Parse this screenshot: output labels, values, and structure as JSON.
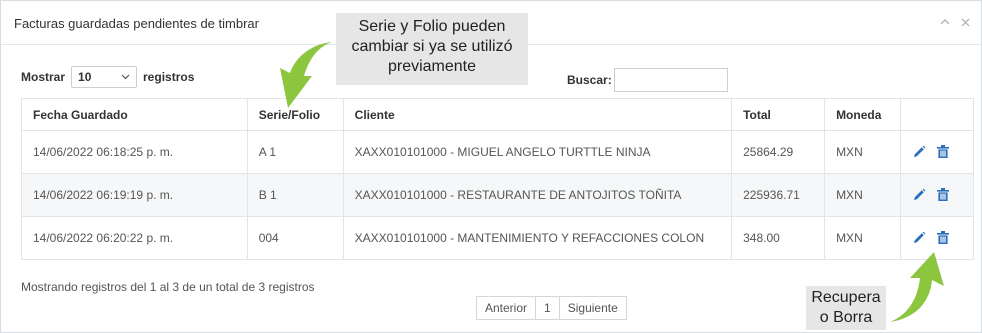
{
  "panel": {
    "title": "Facturas guardadas pendientes de timbrar",
    "collapse_icon": "chevron-up-icon",
    "close_icon": "close-icon"
  },
  "annotations": {
    "serie_note_lines": [
      "Serie y Folio pueden",
      "cambiar si ya se utilizó",
      "previamente"
    ],
    "actions_note_lines": [
      "Recupera",
      "o Borra"
    ],
    "arrow_color": "#8cc63f"
  },
  "controls": {
    "show_label": "Mostrar",
    "page_length": "10",
    "records_label": "registros",
    "search_label": "Buscar:",
    "search_value": ""
  },
  "table": {
    "columns": [
      "Fecha Guardado",
      "Serie/Folio",
      "Cliente",
      "Total",
      "Moneda",
      ""
    ],
    "rows": [
      {
        "fecha": "14/06/2022 06:18:25 p. m.",
        "serie": "A 1",
        "cliente": "XAXX010101000 - MIGUEL ANGELO TURTTLE NINJA",
        "total": "25864.29",
        "moneda": "MXN"
      },
      {
        "fecha": "14/06/2022 06:19:19 p. m.",
        "serie": "B 1",
        "cliente": "XAXX010101000 - RESTAURANTE DE ANTOJITOS TOÑITA",
        "total": "225936.71",
        "moneda": "MXN"
      },
      {
        "fecha": "14/06/2022 06:20:22 p. m.",
        "serie": "004",
        "cliente": "XAXX010101000 - MANTENIMIENTO Y REFACCIONES COLON",
        "total": "348.00",
        "moneda": "MXN"
      }
    ],
    "edit_icon": "pencil-icon",
    "delete_icon": "trash-icon",
    "icon_color": "#2a6ebb"
  },
  "footer": {
    "info": "Mostrando registros del 1 al 3 de un total de 3 registros",
    "prev_label": "Anterior",
    "current_page": "1",
    "next_label": "Siguiente"
  }
}
